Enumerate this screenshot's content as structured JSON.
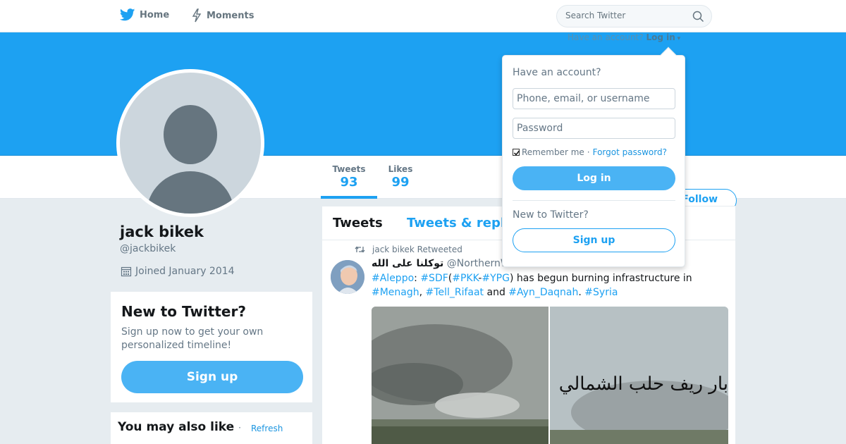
{
  "nav": {
    "home_label": "Home",
    "moments_label": "Moments",
    "search_placeholder": "Search Twitter"
  },
  "login_hint": {
    "text": "Have an account?",
    "link": "Log in"
  },
  "profile": {
    "name": "jack bikek",
    "handle": "@jackbikek",
    "joined": "Joined January 2014",
    "follow_label": "Follow"
  },
  "stats": {
    "tweets_label": "Tweets",
    "tweets_value": "93",
    "likes_label": "Likes",
    "likes_value": "99"
  },
  "signup_card": {
    "title": "New to Twitter?",
    "body": "Sign up now to get your own personalized timeline!",
    "button": "Sign up"
  },
  "wtf": {
    "title": "You may also like",
    "sep": "·",
    "refresh": "Refresh"
  },
  "timeline": {
    "tab_tweets": "Tweets",
    "tab_replies": "Tweets & repl",
    "tweet": {
      "retweet_context": "jack bikek Retweeted",
      "fullname": "توكلنا على الله",
      "screen_name": "@NorthernWatcher",
      "text_parts": {
        "t1": "#Aleppo",
        "t2": ": ",
        "t3": "#SDF",
        "t4": "(",
        "t5": "#PKK",
        "t6": "-",
        "t7": "#YPG",
        "t8": ") has begun burning infrastructure in ",
        "t9": "#Menagh",
        "t10": ", ",
        "t11": "#Tell_Rifaat",
        "t12": " and ",
        "t13": "#Ayn_Daqnah",
        "t14": ". ",
        "t15": "#Syria"
      },
      "image_overlay_text": "بار ريف حلب الشمالي"
    }
  },
  "login_dropdown": {
    "title": "Have an account?",
    "username_placeholder": "Phone, email, or username",
    "password_placeholder": "Password",
    "remember": "Remember me",
    "sep": "·",
    "forgot": "Forgot password?",
    "login_button": "Log in",
    "new_to_twitter": "New to Twitter?",
    "signup_button": "Sign up"
  },
  "colors": {
    "accent": "#1da1f2",
    "button_blue": "#4ab3f4",
    "link": "#1b95e0",
    "background": "#e6ecf0"
  }
}
